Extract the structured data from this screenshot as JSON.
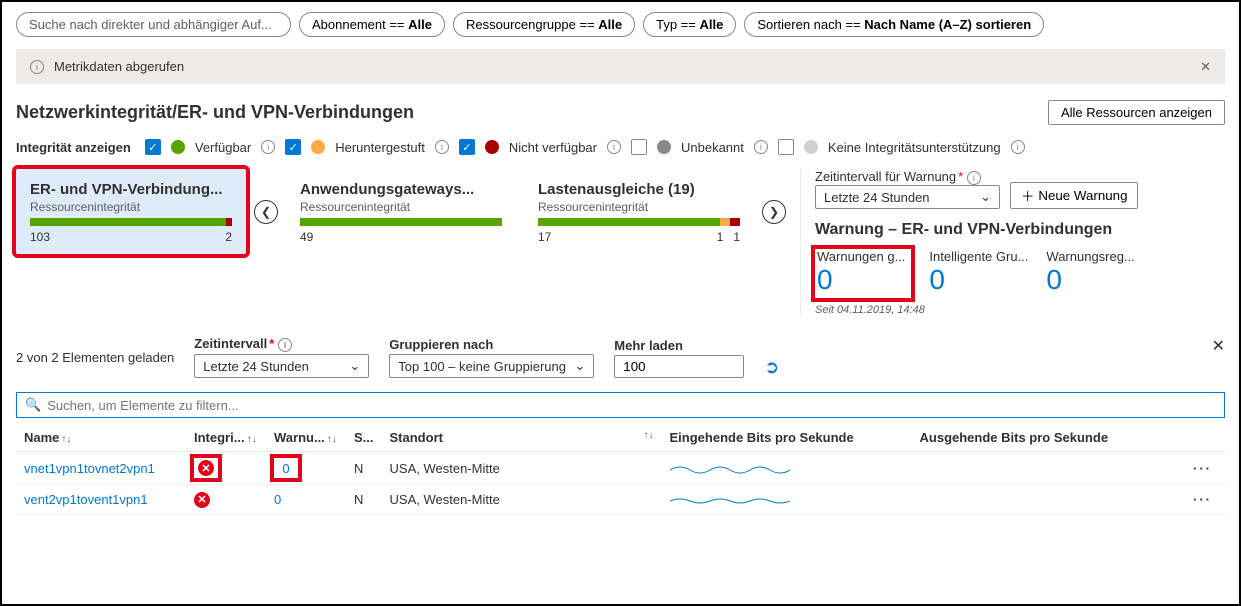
{
  "filters": {
    "search_placeholder": "Suche nach direkter und abhängiger Auf...",
    "subscription": {
      "label": "Abonnement == ",
      "value": "Alle"
    },
    "resource_group": {
      "label": "Ressourcengruppe == ",
      "value": "Alle"
    },
    "type": {
      "label": "Typ == ",
      "value": "Alle"
    },
    "sort": {
      "label": "Sortieren nach == ",
      "value": "Nach Name (A–Z) sortieren"
    }
  },
  "info_bar": "Metrikdaten abgerufen",
  "page_title": "Netzwerkintegrität/ER- und VPN-Verbindungen",
  "view_all_btn": "Alle Ressourcen anzeigen",
  "health_label": "Integrität anzeigen",
  "health_opts": {
    "available": "Verfügbar",
    "degraded": "Heruntergestuft",
    "unavailable": "Nicht verfügbar",
    "unknown": "Unbekannt",
    "unsupported": "Keine Integritätsunterstützung"
  },
  "cards": [
    {
      "title": "ER- und VPN-Verbindung...",
      "sub": "Ressourcenintegrität",
      "left": "103",
      "right": "2",
      "green": 97,
      "orange": 0,
      "red": 3
    },
    {
      "title": "Anwendungsgateways...",
      "sub": "Ressourcenintegrität",
      "left": "49",
      "right": "",
      "green": 100,
      "orange": 0,
      "red": 0
    },
    {
      "title": "Lastenausgleiche (19)",
      "sub": "Ressourcenintegrität",
      "left": "17",
      "right": "1   1",
      "green": 90,
      "orange": 5,
      "red": 5
    }
  ],
  "alerts": {
    "range_label": "Zeitintervall für Warnung",
    "range_value": "Letzte 24 Stunden",
    "new_alert": "Neue Warnung",
    "heading": "Warnung – ER- und VPN-Verbindungen",
    "cols": [
      {
        "title": "Warnungen g...",
        "value": "0"
      },
      {
        "title": "Intelligente Gru...",
        "value": "0"
      },
      {
        "title": "Warnungsreg...",
        "value": "0"
      }
    ],
    "since": "Seit 04.11.2019, 14:48"
  },
  "grid_filters": {
    "loaded": "2 von 2 Elementen geladen",
    "time_label": "Zeitintervall",
    "time_value": "Letzte 24 Stunden",
    "group_label": "Gruppieren nach",
    "group_value": "Top 100 – keine Gruppierung",
    "more_label": "Mehr laden",
    "more_value": "100"
  },
  "table_search": "Suchen, um Elemente zu filtern...",
  "columns": {
    "name": "Name",
    "health": "Integri...",
    "alerts": "Warnu...",
    "s": "S...",
    "location": "Standort",
    "in": "Eingehende Bits pro Sekunde",
    "out": "Ausgehende Bits pro Sekunde"
  },
  "rows": [
    {
      "name": "vnet1vpn1tovnet2vpn1",
      "alerts": "0",
      "s": "N",
      "location": "USA, Westen-Mitte"
    },
    {
      "name": "vent2vp1tovent1vpn1",
      "alerts": "0",
      "s": "N",
      "location": "USA, Westen-Mitte"
    }
  ]
}
